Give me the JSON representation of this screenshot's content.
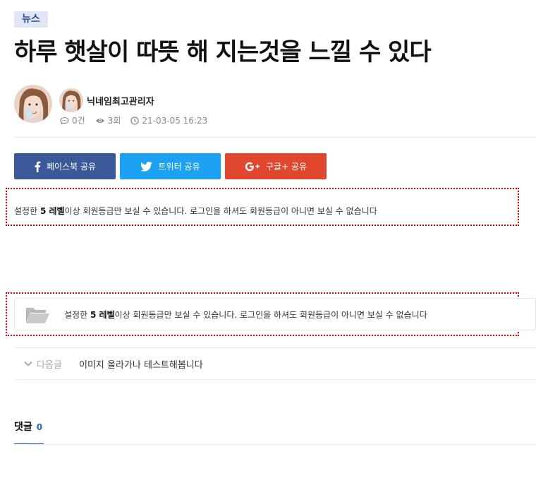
{
  "post": {
    "category": "뉴스",
    "title": "하루 햇살이 따뜻 해 지는것을 느낄 수 있다",
    "author": "닉네임최고관리자",
    "comment_count": "0건",
    "view_count": "3회",
    "datetime": "21-03-05 16:23"
  },
  "share": {
    "facebook": "페이스북 공유",
    "twitter": "트위터 공유",
    "google": "구글+ 공유",
    "colors": {
      "facebook": "#3b5998",
      "twitter": "#1da1f2",
      "google": "#e1462f"
    }
  },
  "notice": {
    "prefix": "설정한 ",
    "level": "5 레벨",
    "suffix": "이상 회원등급만 보실 수 있습니다. 로그인을 하셔도 회원등급이 아니면 보실 수 없습니다"
  },
  "navigation": {
    "next_label": "다음글",
    "next_title": "이미지 올라가나 테스트해봅니다"
  },
  "comments": {
    "label": "댓글",
    "count": "0"
  },
  "icons": {
    "comment": "comment-icon",
    "view": "eye-icon",
    "time": "clock-icon",
    "facebook": "facebook-icon",
    "twitter": "twitter-icon",
    "google": "google-plus-icon",
    "folder": "folder-open-icon",
    "chevron": "chevron-down-icon"
  }
}
